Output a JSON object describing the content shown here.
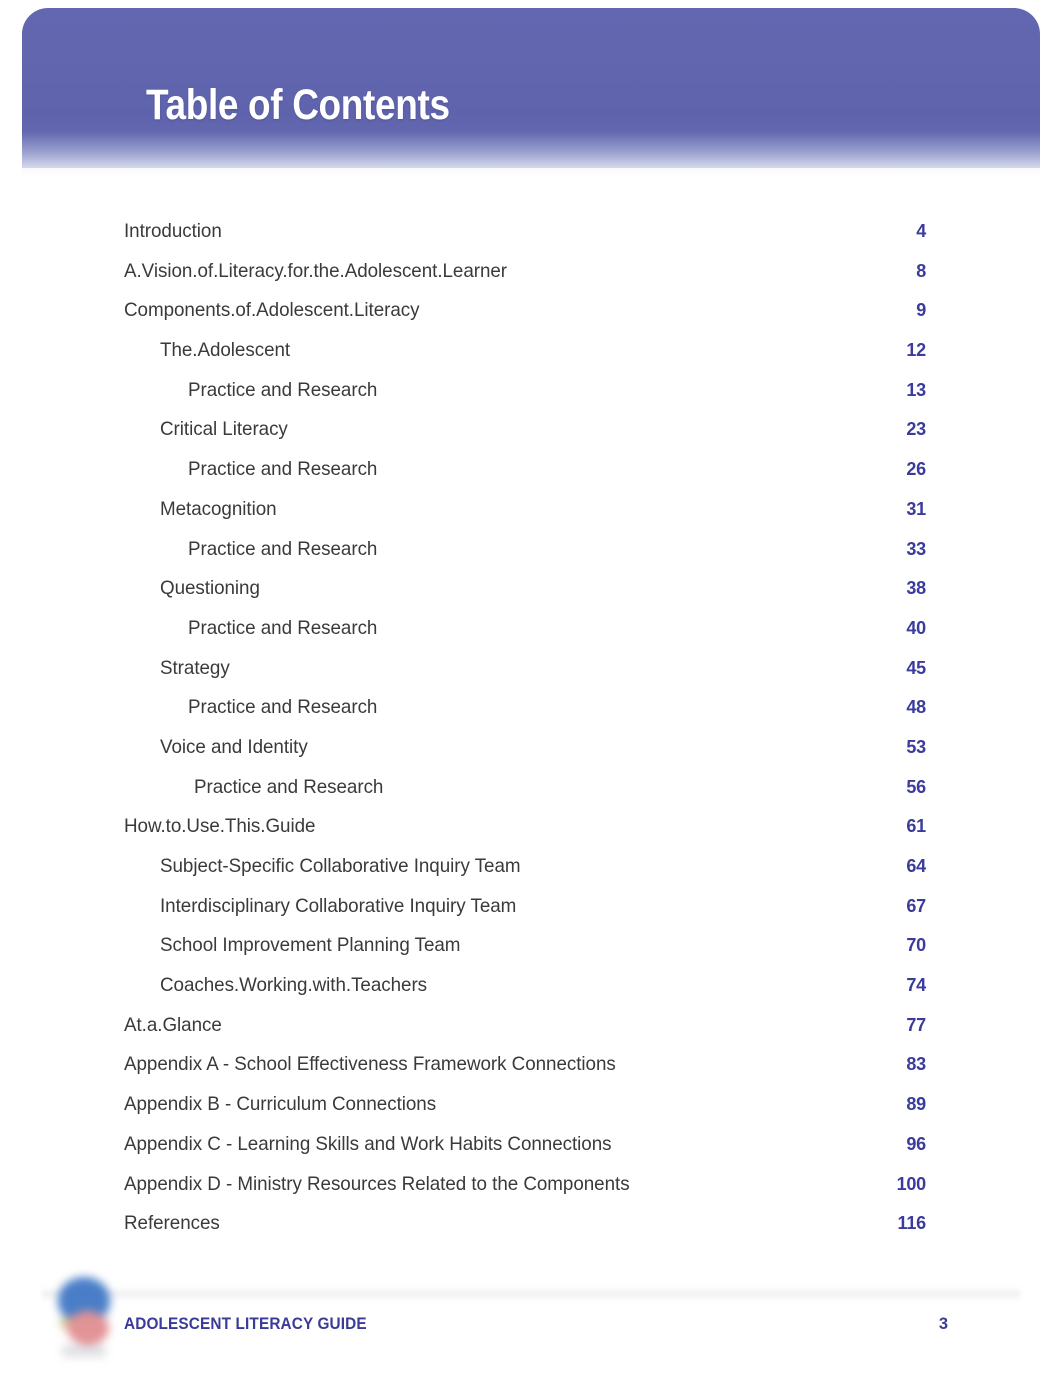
{
  "header": {
    "title": "Table of Contents",
    "banner_color": "#6165ae",
    "title_color": "#ffffff"
  },
  "toc": {
    "page_number_color": "#3b3b9e",
    "text_color": "#3a3a3a",
    "entries": [
      {
        "title": "Introduction",
        "page": "4",
        "level": 0
      },
      {
        "title": "A.Vision.of.Literacy.for.the.Adolescent.Learner",
        "page": "8",
        "level": 0
      },
      {
        "title": "Components.of.Adolescent.Literacy",
        "page": "9",
        "level": 0
      },
      {
        "title": "The.Adolescent",
        "page": "12",
        "level": 1
      },
      {
        "title": "Practice and Research",
        "page": "13",
        "level": 2
      },
      {
        "title": "Critical Literacy",
        "page": "23",
        "level": 1
      },
      {
        "title": "Practice and Research",
        "page": "26",
        "level": 2
      },
      {
        "title": "Metacognition",
        "page": "31",
        "level": 1
      },
      {
        "title": "Practice and Research",
        "page": "33",
        "level": 2
      },
      {
        "title": "Questioning",
        "page": "38",
        "level": 1
      },
      {
        "title": "Practice and Research",
        "page": "40",
        "level": 2
      },
      {
        "title": "Strategy",
        "page": "45",
        "level": 1
      },
      {
        "title": "Practice and Research",
        "page": "48",
        "level": 2
      },
      {
        "title": "Voice and Identity",
        "page": "53",
        "level": 1
      },
      {
        "title": "Practice and Research",
        "page": "56",
        "level": 3
      },
      {
        "title": "How.to.Use.This.Guide",
        "page": "61",
        "level": 0
      },
      {
        "title": "Subject-Specific Collaborative Inquiry Team",
        "page": "64",
        "level": 1
      },
      {
        "title": "Interdisciplinary Collaborative Inquiry Team",
        "page": "67",
        "level": 1
      },
      {
        "title": "School Improvement Planning Team",
        "page": "70",
        "level": 1
      },
      {
        "title": "Coaches.Working.with.Teachers",
        "page": "74",
        "level": 1
      },
      {
        "title": "At.a.Glance",
        "page": "77",
        "level": 0
      },
      {
        "title": "Appendix A - School Effectiveness Framework Connections",
        "page": "83",
        "level": 0
      },
      {
        "title": "Appendix B - Curriculum Connections",
        "page": "89",
        "level": 0
      },
      {
        "title": "Appendix C - Learning Skills and Work Habits Connections",
        "page": "96",
        "level": 0
      },
      {
        "title": "Appendix D - Ministry Resources Related to the Components",
        "page": "100",
        "level": 0
      },
      {
        "title": "References",
        "page": "116",
        "level": 0
      }
    ]
  },
  "footer": {
    "label": "ADOLESCENT LITERACY GUIDE",
    "page_number": "3",
    "text_color": "#3a3a99",
    "logo": "ontario-trillium-logo"
  }
}
